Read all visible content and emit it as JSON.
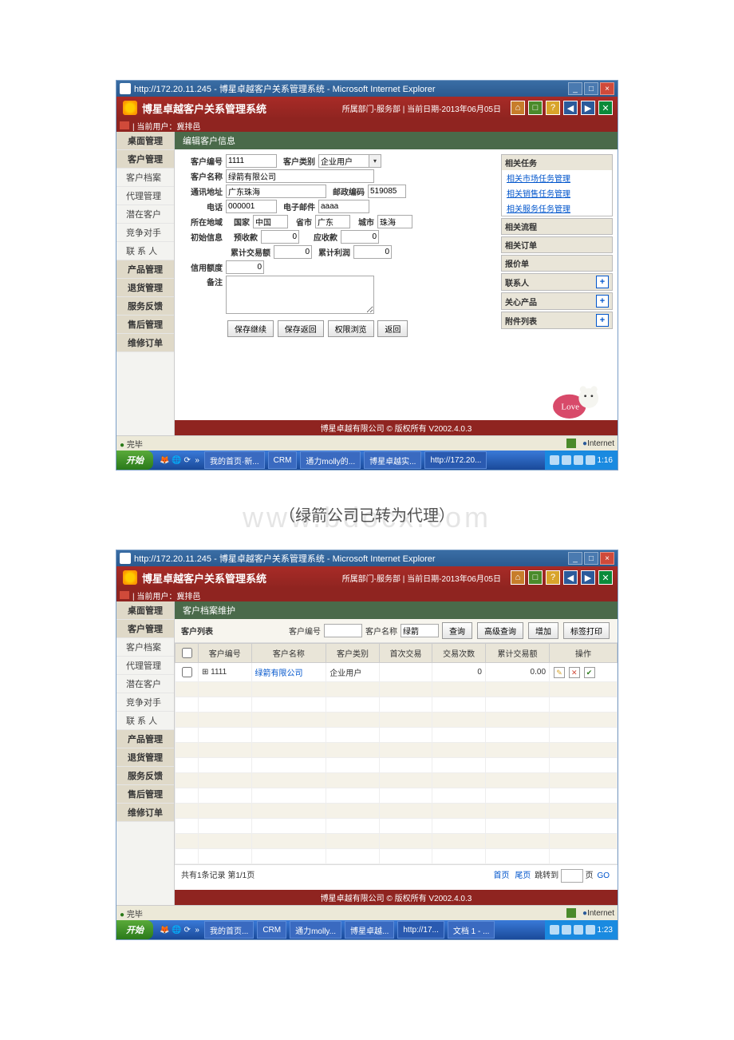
{
  "window": {
    "title": "http://172.20.11.245 - 博星卓越客户关系管理系统 - Microsoft Internet Explorer"
  },
  "banner": {
    "title": "博星卓越客户关系管理系统",
    "info": "所属部门-服务部   |  当前日期-2013年06月05日"
  },
  "userline": "|  当前用户：冀排邑",
  "sidebar": [
    {
      "label": "桌面管理",
      "type": "head"
    },
    {
      "label": "客户管理",
      "type": "head"
    },
    {
      "label": "客户档案",
      "type": "sub"
    },
    {
      "label": "代理管理",
      "type": "sub"
    },
    {
      "label": "潜在客户",
      "type": "sub"
    },
    {
      "label": "竞争对手",
      "type": "sub"
    },
    {
      "label": "联 系 人",
      "type": "sub"
    },
    {
      "label": "产品管理",
      "type": "head"
    },
    {
      "label": "退货管理",
      "type": "head"
    },
    {
      "label": "服务反馈",
      "type": "head"
    },
    {
      "label": "售后管理",
      "type": "head"
    },
    {
      "label": "维修订单",
      "type": "head"
    }
  ],
  "content1": {
    "title": "编辑客户信息",
    "fields": {
      "code_lbl": "客户编号",
      "code": "1111",
      "type_lbl": "客户类别",
      "type": "企业用户",
      "name_lbl": "客户名称",
      "name": "绿箭有限公司",
      "addr_lbl": "通讯地址",
      "addr": "广东珠海",
      "post_lbl": "邮政编码",
      "post": "519085",
      "tel_lbl": "电话",
      "tel": "000001",
      "email_lbl": "电子邮件",
      "email": "aaaa",
      "region_lbl": "所在地域",
      "country_lbl": "国家",
      "country": "中国",
      "prov_lbl": "省市",
      "prov": "广东",
      "city_lbl": "城市",
      "city": "珠海",
      "init_lbl": "初始信息",
      "pre_lbl": "预收款",
      "pre": "0",
      "due_lbl": "应收款",
      "due": "0",
      "tot_lbl": "累计交易额",
      "tot": "0",
      "profit_lbl": "累计利润",
      "profit": "0",
      "credit_lbl": "信用额度",
      "credit": "0",
      "remark_lbl": "备注",
      "remark": ""
    },
    "buttons": {
      "b1": "保存继续",
      "b2": "保存返回",
      "b3": "权限浏览",
      "b4": "返回"
    },
    "right": {
      "tasks": "相关任务",
      "t1": "相关市场任务管理",
      "t2": "相关销售任务管理",
      "t3": "相关服务任务管理",
      "flows": "相关流程",
      "orders": "相关订单",
      "quote": "报价单",
      "contact": "联系人",
      "prod": "关心产品",
      "attach": "附件列表"
    }
  },
  "copyright": "博星卓越有限公司 © 版权所有  V2002.4.0.3",
  "status": {
    "done": "完毕",
    "net": "Internet"
  },
  "task1": {
    "start": "开始",
    "t1": "我的首页·新...",
    "t2": "CRM",
    "t3": "通力molly的...",
    "t4": "博星卓越实...",
    "t5": "http://172.20...",
    "time": "1:16"
  },
  "caption": "（绿箭公司已转为代理）",
  "watermark": "www.bdocx.com",
  "content2": {
    "title": "客户档案维护",
    "list_lbl": "客户列表",
    "filter": {
      "code_lbl": "客户编号",
      "name_lbl": "客户名称",
      "name": "绿箭",
      "q": "查询",
      "aq": "高级查询",
      "add": "增加",
      "print": "标签打印"
    },
    "cols": {
      "c1": "客户编号",
      "c2": "客户名称",
      "c3": "客户类别",
      "c4": "首次交易",
      "c5": "交易次数",
      "c6": "累计交易额",
      "c7": "操作"
    },
    "row": {
      "code": "1111",
      "name": "绿箭有限公司",
      "type": "企业用户",
      "first": "",
      "count": "0",
      "total": "0.00"
    },
    "pager": {
      "summary": "共有1条记录 第1/1页",
      "first": "首页",
      "last": "尾页",
      "jump": "跳转到",
      "go": "GO",
      "page_lbl": "页"
    }
  },
  "task2": {
    "t1": "我的首页...",
    "t2": "CRM",
    "t3": "通力molly...",
    "t4": "博星卓越...",
    "t5": "http://17...",
    "t6": "文档 1 - ...",
    "time": "1:23"
  }
}
